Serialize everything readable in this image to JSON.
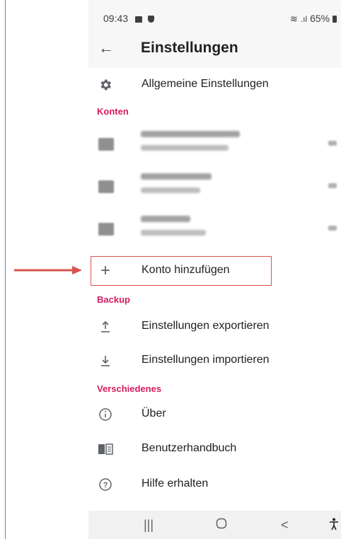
{
  "status_bar": {
    "time": "09:43",
    "battery": "65%"
  },
  "app_bar": {
    "title": "Einstellungen"
  },
  "items": {
    "general": "Allgemeine Einstellungen",
    "add_account": "Konto hinzufügen",
    "export": "Einstellungen exportieren",
    "import": "Einstellungen importieren",
    "about": "Über",
    "manual": "Benutzerhandbuch",
    "help": "Hilfe erhalten"
  },
  "sections": {
    "accounts": "Konten",
    "backup": "Backup",
    "misc": "Verschiedenes"
  },
  "accounts": [
    {},
    {},
    {}
  ],
  "colors": {
    "accent": "#d81b60",
    "highlight": "#d9534f",
    "arrow": "#d9534f"
  }
}
